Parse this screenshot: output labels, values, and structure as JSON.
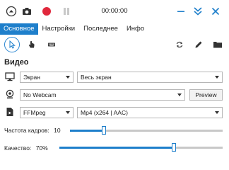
{
  "header": {
    "timer": "00:00:00"
  },
  "colors": {
    "accent": "#1e7fcb",
    "record": "#e0283c"
  },
  "tabs": [
    {
      "label": "Основное",
      "active": true
    },
    {
      "label": "Настройки",
      "active": false
    },
    {
      "label": "Последнее",
      "active": false
    },
    {
      "label": "Инфо",
      "active": false
    }
  ],
  "section": {
    "title": "Видео"
  },
  "video": {
    "source": "Экран",
    "region": "Весь экран",
    "webcam": "No Webcam",
    "preview_label": "Preview",
    "encoder": "FFMpeg",
    "format": "Mp4 (x264 | AAC)"
  },
  "sliders": {
    "framerate": {
      "label": "Частота кадров:",
      "value": "10",
      "level": 0.22
    },
    "quality": {
      "label": "Качество:",
      "value": "70%",
      "level": 0.7
    }
  }
}
